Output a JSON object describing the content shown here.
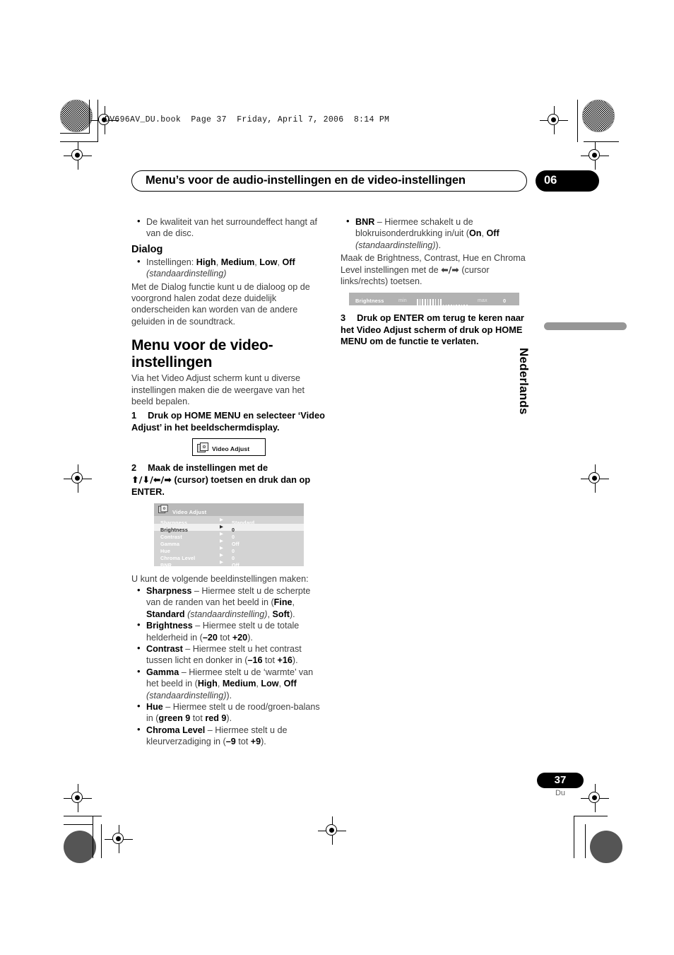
{
  "file_header": "DV696AV_DU.book  Page 37  Friday, April 7, 2006  8:14 PM",
  "header": {
    "chapter_title": "Menu’s voor de audio-instellingen en de video-instellingen",
    "chapter_number": "06"
  },
  "left_column": {
    "surround_bullet": "De kwaliteit van het surroundeffect hangt af van de disc.",
    "dialog_heading": "Dialog",
    "dialog_bullet": {
      "prefix": "Instellingen: ",
      "options": [
        "High",
        "Medium",
        "Low",
        "Off"
      ],
      "default_note": "(standaardinstelling)"
    },
    "dialog_para": "Met de Dialog functie kunt u de dialoog op de voorgrond halen zodat deze duidelijk onderscheiden kan worden van de andere geluiden in de soundtrack.",
    "video_heading": "Menu voor de video-instellingen",
    "video_intro": "Via het Video Adjust scherm kunt u diverse instellingen maken die de weergave van het beeld bepalen.",
    "step1_num": "1",
    "step1_text": "Druk op HOME MENU en selecteer ‘Video Adjust’ in het beeldschermdisplay.",
    "figure_button": {
      "icon": "disc-icon",
      "label": "Video Adjust"
    },
    "step2_num": "2",
    "step2_line1": "Maak de instellingen met de",
    "step2_cursors": "⬆/⬇/⬅/➡",
    "step2_line2": "(cursor) toetsen en druk dan op ENTER.",
    "figure_osd": {
      "icon": "disc-icon",
      "title": "Video Adjust",
      "arrow": "▶",
      "rows": [
        {
          "name": "Sharpness",
          "value": "Standard",
          "selected": false
        },
        {
          "name": "Brightness",
          "value": "0",
          "selected": true
        },
        {
          "name": "Contrast",
          "value": "0",
          "selected": false
        },
        {
          "name": "Gamma",
          "value": "Off",
          "selected": false
        },
        {
          "name": "Hue",
          "value": "0",
          "selected": false
        },
        {
          "name": "Chroma Level",
          "value": "0",
          "selected": false
        },
        {
          "name": "BNR",
          "value": "Off",
          "selected": false
        }
      ]
    },
    "list_intro": "U kunt de volgende beeldinstellingen maken:",
    "settings": [
      {
        "term": "Sharpness",
        "desc_1": " – Hiermee stelt u de scherpte van de randen van het beeld in (",
        "opt_1": "Fine",
        "sep_1": ", ",
        "opt_2": "Standard",
        "italic_1": " (standaardinstelling)",
        "sep_2": ", ",
        "opt_3": "Soft",
        "tail": ")."
      },
      {
        "term": "Brightness",
        "desc_1": " – Hiermee stelt u de totale helderheid in (",
        "opt_1": "–20",
        "sep_1": " tot ",
        "opt_2": "+20",
        "tail": ")."
      },
      {
        "term": "Contrast",
        "desc_1": " – Hiermee stelt u het contrast tussen licht en donker in (",
        "opt_1": "–16",
        "sep_1": " tot ",
        "opt_2": "+16",
        "tail": ")."
      },
      {
        "term": "Gamma",
        "desc_1": " – Hiermee stelt u de ‘warmte’ van het beeld in (",
        "opt_1": "High",
        "sep_1": ", ",
        "opt_2": "Medium",
        "sep_2": ", ",
        "opt_3": "Low",
        "sep_3": ", ",
        "opt_4": "Off",
        "italic_1": " (standaardinstelling)",
        "tail": ")."
      },
      {
        "term": "Hue",
        "desc_1": " – Hiermee stelt u de rood/groen-balans in (",
        "opt_1": "green 9",
        "sep_1": " tot ",
        "opt_2": "red 9",
        "tail": ")."
      },
      {
        "term": "Chroma Level",
        "desc_1": " – Hiermee stelt u de kleurverzadiging in (",
        "opt_1": "–9",
        "sep_1": " tot ",
        "opt_2": "+9",
        "tail": ")."
      }
    ]
  },
  "right_column": {
    "bnr_bullet": {
      "term": "BNR",
      "desc_1": " – Hiermee schakelt u de blokruisonderdrukking in/uit (",
      "opt_1": "On",
      "sep_1": ", ",
      "opt_2": "Off",
      "italic_1": " (standaardinstelling)",
      "tail": ")."
    },
    "adjust_para_1": "Maak de Brightness, Contrast, Hue en Chroma Level instellingen met de ",
    "adjust_cursors": "⬅/➡",
    "adjust_para_2": " (cursor links/rechts) toetsen.",
    "figure_slider": {
      "label": "Brightness",
      "min_label": "min",
      "max_label": "max",
      "value": "0",
      "filled_segments": 10,
      "empty_segments": 10
    },
    "step3_num": "3",
    "step3_text": "Druk op ENTER om terug te keren naar het Video Adjust scherm of druk op HOME MENU om de functie te verlaten."
  },
  "side_tab": {
    "language": "Nederlands"
  },
  "footer": {
    "page_number": "37",
    "language_code": "Du"
  },
  "colors": {
    "osd_background": "#d3d3d3",
    "osd_title_bar": "#b9b9b9",
    "osd_selected_row": "#f0f0f0",
    "slider_background": "#b2b2b2",
    "lang_tab": "#969696",
    "body_text": "#3e3e3e"
  }
}
